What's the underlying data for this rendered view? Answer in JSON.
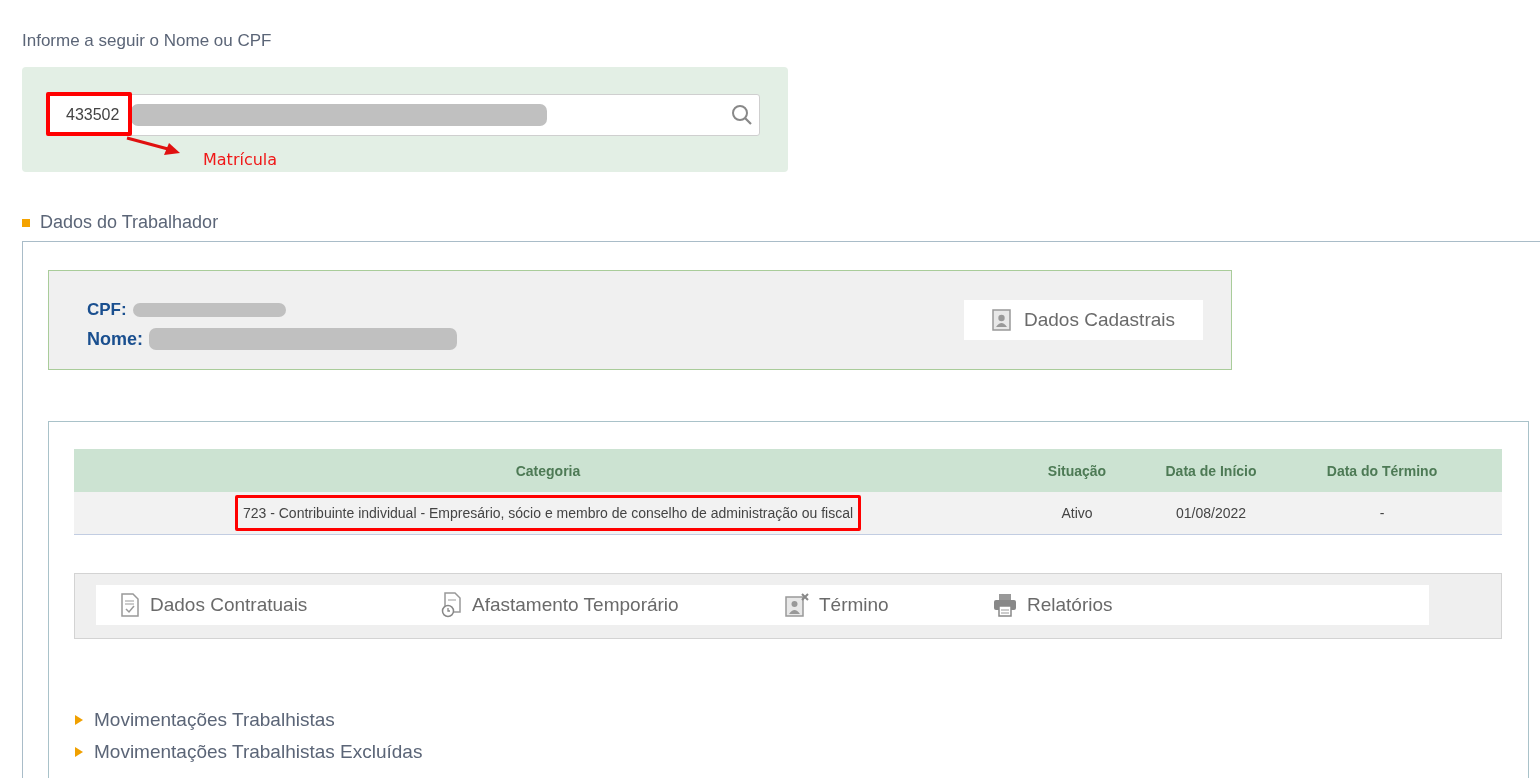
{
  "search_section": {
    "prompt": "Informe a seguir o Nome ou CPF",
    "search": {
      "value": "433502"
    },
    "annotation": {
      "label": "Matrícula"
    }
  },
  "worker_section": {
    "title": "Dados do Trabalhador",
    "worker_card": {
      "cpf_label": "CPF:",
      "name_label": "Nome:",
      "button": "Dados Cadastrais"
    },
    "table": {
      "columns": [
        "Categoria",
        "Situação",
        "Data de Início",
        "Data do Término"
      ],
      "rows": [
        {
          "cells": [
            "723 - Contribuinte individual - Empresário, sócio e membro de conselho de administração ou fiscal",
            "Ativo",
            "01/08/2022",
            "-"
          ],
          "highlighted": true
        }
      ]
    },
    "actions": [
      {
        "kind": "contract",
        "label": "Dados Contratuais"
      },
      {
        "kind": "leave",
        "label": "Afastamento Temporário"
      },
      {
        "kind": "end",
        "label": "Término"
      },
      {
        "kind": "print",
        "label": "Relatórios"
      }
    ],
    "expandables": [
      {
        "label": "Movimentações Trabalhistas",
        "expanded": false
      },
      {
        "label": "Movimentações Trabalhistas Excluídas",
        "expanded": false
      }
    ]
  }
}
